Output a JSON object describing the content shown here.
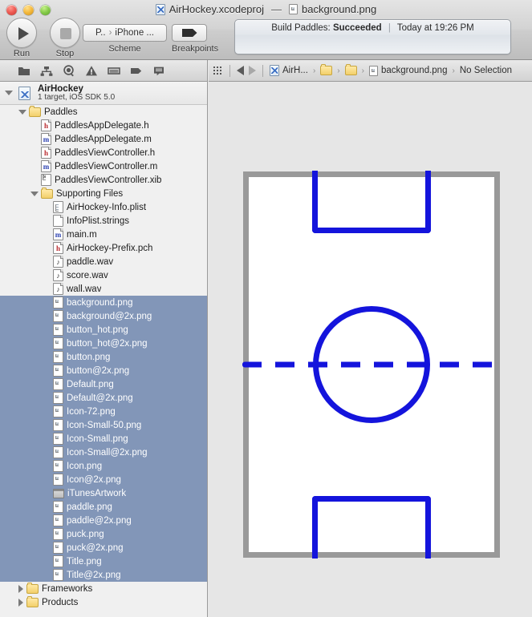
{
  "window": {
    "title_project": "AirHockey.xcodeproj",
    "title_separator": "—",
    "title_file": "background.png",
    "traffic_lights": [
      "close-button",
      "minimize-button",
      "zoom-button"
    ]
  },
  "toolbar": {
    "run_label": "Run",
    "stop_label": "Stop",
    "scheme_label": "Scheme",
    "scheme_target": "P..",
    "scheme_chevron": "›",
    "scheme_destination": "iPhone ...",
    "breakpoints_label": "Breakpoints"
  },
  "status": {
    "prefix": "Build Paddles:",
    "result": "Succeeded",
    "divider": "|",
    "time": "Today at 19:26 PM"
  },
  "navigator_toolbar": {
    "icons": [
      "project-navigator-icon",
      "symbol-navigator-icon",
      "search-navigator-icon",
      "issue-navigator-icon",
      "test-navigator-icon",
      "debug-navigator-icon",
      "log-navigator-icon"
    ]
  },
  "jump_bar": {
    "grid_icon": "related-items-icon",
    "back_icon": "back-arrow-icon",
    "forward_icon": "forward-arrow-icon",
    "crumbs": [
      {
        "label": "AirH...",
        "icon": "project-icon"
      },
      {
        "label": "",
        "icon": "folder-icon"
      },
      {
        "label": "",
        "icon": "folder-icon"
      },
      {
        "label": "background.png",
        "icon": "image-file-icon"
      },
      {
        "label": "No Selection",
        "icon": ""
      }
    ],
    "chevron": "›"
  },
  "project": {
    "name": "AirHockey",
    "subtitle": "1 target, iOS SDK 5.0",
    "icon": "xcode-project-icon",
    "expanded": true
  },
  "tree": [
    {
      "label": "Paddles",
      "kind": "folder",
      "indent": 1,
      "disclosure": "open",
      "selected": false
    },
    {
      "label": "PaddlesAppDelegate.h",
      "kind": "header",
      "indent": 2,
      "disclosure": "none",
      "selected": false
    },
    {
      "label": "PaddlesAppDelegate.m",
      "kind": "source",
      "indent": 2,
      "disclosure": "none",
      "selected": false
    },
    {
      "label": "PaddlesViewController.h",
      "kind": "header",
      "indent": 2,
      "disclosure": "none",
      "selected": false
    },
    {
      "label": "PaddlesViewController.m",
      "kind": "source",
      "indent": 2,
      "disclosure": "none",
      "selected": false
    },
    {
      "label": "PaddlesViewController.xib",
      "kind": "xib",
      "indent": 2,
      "disclosure": "none",
      "selected": false
    },
    {
      "label": "Supporting Files",
      "kind": "folder",
      "indent": 2,
      "disclosure": "open",
      "selected": false
    },
    {
      "label": "AirHockey-Info.plist",
      "kind": "plist",
      "indent": 3,
      "disclosure": "none",
      "selected": false
    },
    {
      "label": "InfoPlist.strings",
      "kind": "plain",
      "indent": 3,
      "disclosure": "none",
      "selected": false
    },
    {
      "label": "main.m",
      "kind": "source",
      "indent": 3,
      "disclosure": "none",
      "selected": false
    },
    {
      "label": "AirHockey-Prefix.pch",
      "kind": "header",
      "indent": 3,
      "disclosure": "none",
      "selected": false
    },
    {
      "label": "paddle.wav",
      "kind": "audio",
      "indent": 3,
      "disclosure": "none",
      "selected": false
    },
    {
      "label": "score.wav",
      "kind": "audio",
      "indent": 3,
      "disclosure": "none",
      "selected": false
    },
    {
      "label": "wall.wav",
      "kind": "audio",
      "indent": 3,
      "disclosure": "none",
      "selected": false
    },
    {
      "label": "background.png",
      "kind": "image",
      "indent": 3,
      "disclosure": "none",
      "selected": true
    },
    {
      "label": "background@2x.png",
      "kind": "image",
      "indent": 3,
      "disclosure": "none",
      "selected": true
    },
    {
      "label": "button_hot.png",
      "kind": "image",
      "indent": 3,
      "disclosure": "none",
      "selected": true
    },
    {
      "label": "button_hot@2x.png",
      "kind": "image",
      "indent": 3,
      "disclosure": "none",
      "selected": true
    },
    {
      "label": "button.png",
      "kind": "image",
      "indent": 3,
      "disclosure": "none",
      "selected": true
    },
    {
      "label": "button@2x.png",
      "kind": "image",
      "indent": 3,
      "disclosure": "none",
      "selected": true
    },
    {
      "label": "Default.png",
      "kind": "image",
      "indent": 3,
      "disclosure": "none",
      "selected": true
    },
    {
      "label": "Default@2x.png",
      "kind": "image",
      "indent": 3,
      "disclosure": "none",
      "selected": true
    },
    {
      "label": "Icon-72.png",
      "kind": "image",
      "indent": 3,
      "disclosure": "none",
      "selected": true
    },
    {
      "label": "Icon-Small-50.png",
      "kind": "image",
      "indent": 3,
      "disclosure": "none",
      "selected": true
    },
    {
      "label": "Icon-Small.png",
      "kind": "image",
      "indent": 3,
      "disclosure": "none",
      "selected": true
    },
    {
      "label": "Icon-Small@2x.png",
      "kind": "image",
      "indent": 3,
      "disclosure": "none",
      "selected": true
    },
    {
      "label": "Icon.png",
      "kind": "image",
      "indent": 3,
      "disclosure": "none",
      "selected": true
    },
    {
      "label": "Icon@2x.png",
      "kind": "image",
      "indent": 3,
      "disclosure": "none",
      "selected": true
    },
    {
      "label": "iTunesArtwork",
      "kind": "artwork",
      "indent": 3,
      "disclosure": "none",
      "selected": true
    },
    {
      "label": "paddle.png",
      "kind": "image",
      "indent": 3,
      "disclosure": "none",
      "selected": true
    },
    {
      "label": "paddle@2x.png",
      "kind": "image",
      "indent": 3,
      "disclosure": "none",
      "selected": true
    },
    {
      "label": "puck.png",
      "kind": "image",
      "indent": 3,
      "disclosure": "none",
      "selected": true
    },
    {
      "label": "puck@2x.png",
      "kind": "image",
      "indent": 3,
      "disclosure": "none",
      "selected": true
    },
    {
      "label": "Title.png",
      "kind": "image",
      "indent": 3,
      "disclosure": "none",
      "selected": true
    },
    {
      "label": "Title@2x.png",
      "kind": "image",
      "indent": 3,
      "disclosure": "none",
      "selected": true
    },
    {
      "label": "Frameworks",
      "kind": "folder",
      "indent": 1,
      "disclosure": "closed",
      "selected": false
    },
    {
      "label": "Products",
      "kind": "folder",
      "indent": 1,
      "disclosure": "closed",
      "selected": false
    }
  ],
  "editor": {
    "image_name": "background.png",
    "description": "air hockey rink artwork",
    "colors": {
      "rink_surface": "#ffffff",
      "rink_border": "#999999",
      "markings": "#1414dc",
      "editor_background": "#e6e6e6",
      "selection": "#8296b8"
    },
    "markings": {
      "goal_top": "top goal crease rectangle",
      "goal_bottom": "bottom goal crease rectangle",
      "center_circle": "center face-off circle",
      "center_line": "dashed center line"
    }
  }
}
